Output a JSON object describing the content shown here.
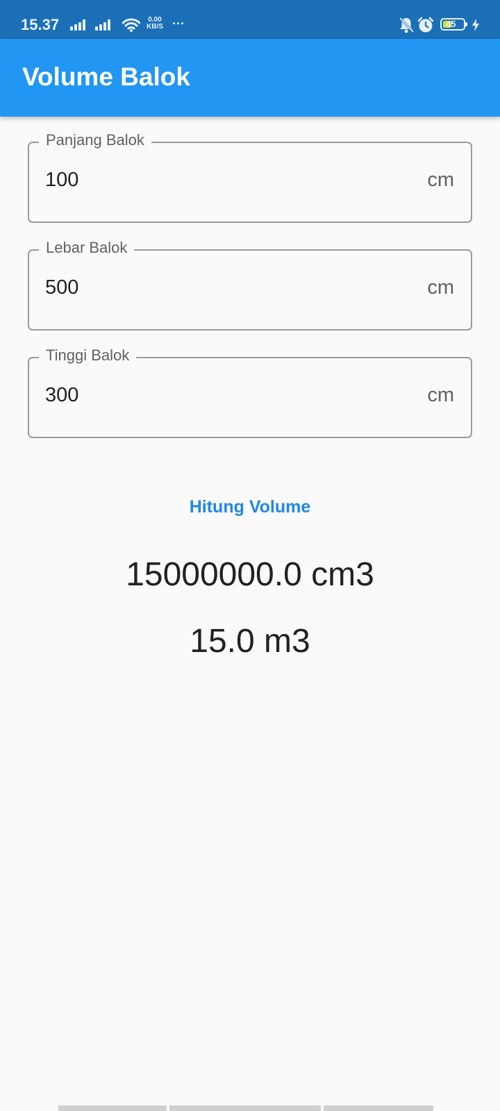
{
  "status_bar": {
    "time": "15.37",
    "net_speed_value": "0.00",
    "net_speed_unit": "KB/S",
    "more": "···",
    "battery": "45",
    "icons": [
      "signal-icon",
      "signal-icon",
      "wifi-icon",
      "bell-off-icon",
      "alarm-icon",
      "battery-icon",
      "charging-icon"
    ]
  },
  "app_bar": {
    "title": "Volume Balok"
  },
  "form": {
    "length": {
      "label": "Panjang Balok",
      "value": "100",
      "suffix": "cm"
    },
    "width": {
      "label": "Lebar Balok",
      "value": "500",
      "suffix": "cm"
    },
    "height": {
      "label": "Tinggi Balok",
      "value": "300",
      "suffix": "cm"
    }
  },
  "button": {
    "label": "Hitung Volume"
  },
  "results": {
    "volume_cm3": "15000000.0 cm3",
    "volume_m3": "15.0 m3"
  },
  "colors": {
    "status_bar": "#1a6fb7",
    "app_bar": "#2196f3",
    "accent": "#1e88e5",
    "background": "#fafafa"
  }
}
